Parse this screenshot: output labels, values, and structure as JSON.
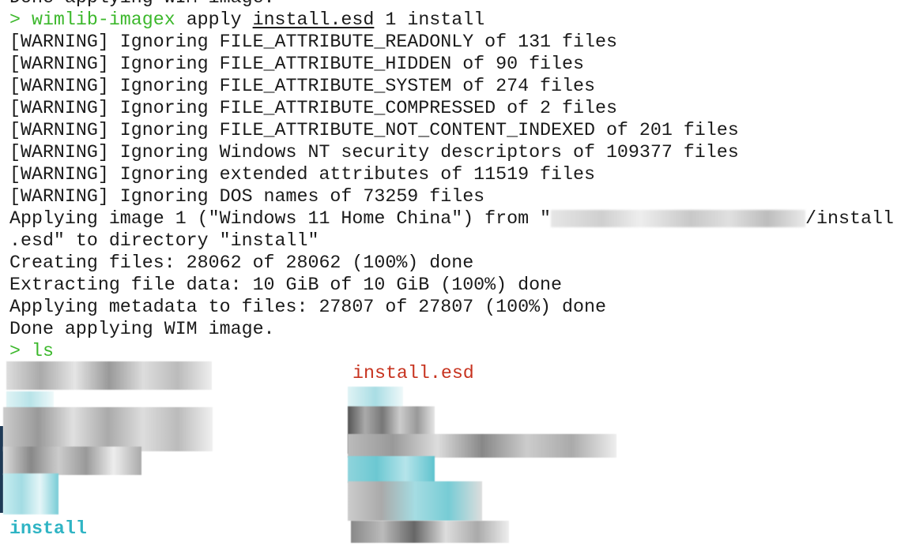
{
  "terminal": {
    "prompt_symbol": ">",
    "lines": [
      "Done applying WIM image.",
      "[WARNING] Ignoring FILE_ATTRIBUTE_READONLY of 131 files",
      "[WARNING] Ignoring FILE_ATTRIBUTE_HIDDEN of 90 files",
      "[WARNING] Ignoring FILE_ATTRIBUTE_SYSTEM of 274 files",
      "[WARNING] Ignoring FILE_ATTRIBUTE_COMPRESSED of 2 files",
      "[WARNING] Ignoring FILE_ATTRIBUTE_NOT_CONTENT_INDEXED of 201 files",
      "[WARNING] Ignoring Windows NT security descriptors of 109377 files",
      "[WARNING] Ignoring extended attributes of 11519 files",
      "[WARNING] Ignoring DOS names of 73259 files",
      "Creating files: 28062 of 28062 (100%) done",
      "Extracting file data: 10 GiB of 10 GiB (100%) done",
      "Applying metadata to files: 27807 of 27807 (100%) done",
      "Done applying WIM image."
    ],
    "command1": {
      "program": "wimlib-imagex",
      "arg1": "apply",
      "file": "install.esd",
      "rest": "1 install"
    },
    "applying_prefix": "Applying image 1 (\"Windows 11 Home China\") from \"",
    "applying_suffix": "/install",
    "applying_line2": ".esd\" to directory \"install\"",
    "command2": "ls",
    "ls_items": {
      "esd": "install.esd",
      "dir": "install"
    }
  },
  "colors": {
    "prompt": "#3cb82c",
    "archive": "#c7331f",
    "directory": "#2fb4c4"
  }
}
